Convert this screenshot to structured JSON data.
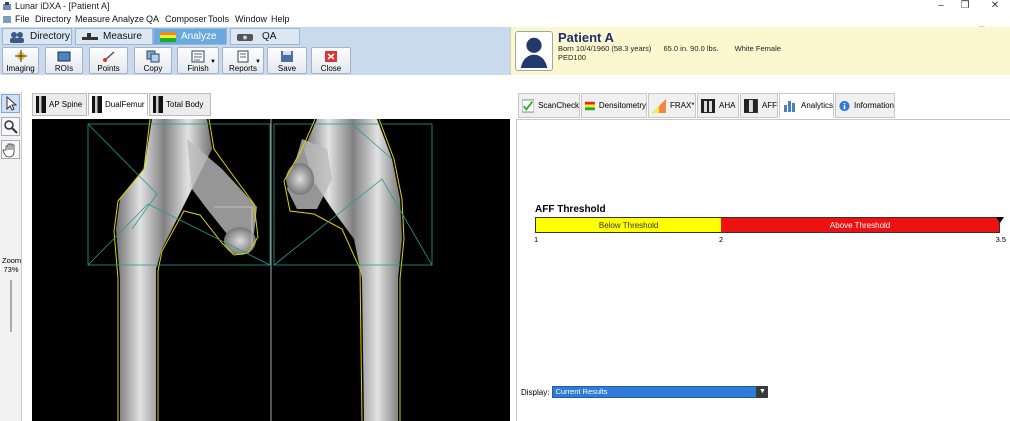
{
  "window": {
    "title": "Lunar iDXA - [Patient A]"
  },
  "menu": {
    "items": [
      "File",
      "Directory",
      "Measure",
      "Analyze",
      "QA",
      "Composer",
      "Tools",
      "Window",
      "Help"
    ]
  },
  "modes": [
    {
      "label": "Directory",
      "icon": "people-icon"
    },
    {
      "label": "Measure",
      "icon": "scanner-icon"
    },
    {
      "label": "Analyze",
      "icon": "analyze-icon",
      "active": true
    },
    {
      "label": "QA",
      "icon": "qa-icon"
    }
  ],
  "toolbar": {
    "buttons": [
      {
        "label": "Imaging",
        "icon": "imaging-icon"
      },
      {
        "label": "ROIs",
        "icon": "roi-icon"
      },
      {
        "label": "Points",
        "icon": "points-icon"
      },
      {
        "label": "Copy",
        "icon": "copy-icon"
      },
      {
        "label": "Finish",
        "icon": "finish-icon",
        "dropdown": true
      },
      {
        "label": "Reports",
        "icon": "reports-icon",
        "dropdown": true
      },
      {
        "label": "Save",
        "icon": "save-icon"
      },
      {
        "label": "Close",
        "icon": "close-icon"
      }
    ]
  },
  "patient": {
    "name": "Patient A",
    "born": "Born 10/4/1960 (58.3 years)",
    "measures": "65.0 in. 90.0 lbs.",
    "demographic": "White Female",
    "id": "PED100"
  },
  "left_tools": {
    "zoom_label": "Zoom",
    "zoom_value": "73%"
  },
  "image_tabs": [
    {
      "label": "AP Spine"
    },
    {
      "label": "DualFemur",
      "active": true
    },
    {
      "label": "Total Body"
    }
  ],
  "analysis_tabs": [
    {
      "label": "ScanCheck",
      "icon": "check-icon"
    },
    {
      "label": "Densitometry",
      "icon": "densitometry-icon"
    },
    {
      "label": "FRAX*",
      "icon": "frax-icon"
    },
    {
      "label": "AHA",
      "icon": "aha-icon"
    },
    {
      "label": "AFF",
      "icon": "aff-icon"
    },
    {
      "label": "Analytics",
      "icon": "analytics-icon",
      "active": true
    },
    {
      "label": "Information",
      "icon": "info-icon"
    }
  ],
  "aff": {
    "title": "AFF Threshold",
    "below_label": "Below Threshold",
    "above_label": "Above Threshold",
    "ticks": [
      "1",
      "2",
      "3.5"
    ],
    "scale": {
      "min": 1,
      "threshold": 2,
      "max": 3.5
    },
    "marker_value": 3.5,
    "colors": {
      "below": "#ffff00",
      "above": "#ee1111"
    }
  },
  "display": {
    "label": "Display:",
    "value": "Current Results"
  }
}
